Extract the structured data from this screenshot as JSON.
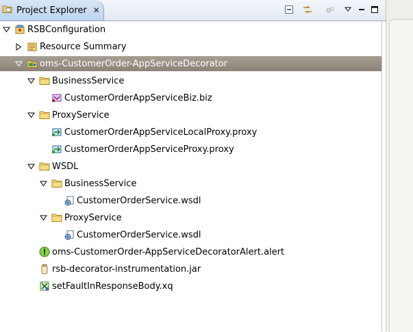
{
  "view": {
    "title": "Project Explorer",
    "close_glyph": "✕"
  },
  "toolbar": [
    {
      "name": "collapse-all-icon"
    },
    {
      "name": "link-with-editor-icon"
    },
    {
      "name": "filter-icon"
    },
    {
      "name": "view-menu-icon"
    },
    {
      "name": "minimize-icon"
    },
    {
      "name": "maximize-icon"
    }
  ],
  "tree": [
    {
      "label": "RSBConfiguration",
      "icon": "project-icon",
      "depth": 0,
      "expanded": true
    },
    {
      "label": "Resource Summary",
      "icon": "resource-summary-icon",
      "depth": 1,
      "expanded": false
    },
    {
      "label": "oms-CustomerOrder-AppServiceDecorator",
      "icon": "project-folder-icon",
      "depth": 1,
      "expanded": true,
      "selected": true
    },
    {
      "label": "BusinessService",
      "icon": "folder-icon",
      "depth": 2,
      "expanded": true
    },
    {
      "label": "CustomerOrderAppServiceBiz.biz",
      "icon": "business-service-icon",
      "depth": 3
    },
    {
      "label": "ProxyService",
      "icon": "folder-icon",
      "depth": 2,
      "expanded": true
    },
    {
      "label": "CustomerOrderAppServiceLocalProxy.proxy",
      "icon": "proxy-service-icon",
      "depth": 3
    },
    {
      "label": "CustomerOrderAppServiceProxy.proxy",
      "icon": "proxy-service-icon",
      "depth": 3
    },
    {
      "label": "WSDL",
      "icon": "folder-icon",
      "depth": 2,
      "expanded": true
    },
    {
      "label": "BusinessService",
      "icon": "folder-icon",
      "depth": 3,
      "expanded": true
    },
    {
      "label": "CustomerOrderService.wsdl",
      "icon": "wsdl-icon",
      "depth": 4
    },
    {
      "label": "ProxyService",
      "icon": "folder-icon",
      "depth": 3,
      "expanded": true
    },
    {
      "label": "CustomerOrderService.wsdl",
      "icon": "wsdl-icon",
      "depth": 4
    },
    {
      "label": "oms-CustomerOrder-AppServiceDecoratorAlert.alert",
      "icon": "alert-icon",
      "depth": 2
    },
    {
      "label": "rsb-decorator-instrumentation.jar",
      "icon": "jar-icon",
      "depth": 2
    },
    {
      "label": "setFaultInResponseBody.xq",
      "icon": "xquery-icon",
      "depth": 2
    }
  ]
}
